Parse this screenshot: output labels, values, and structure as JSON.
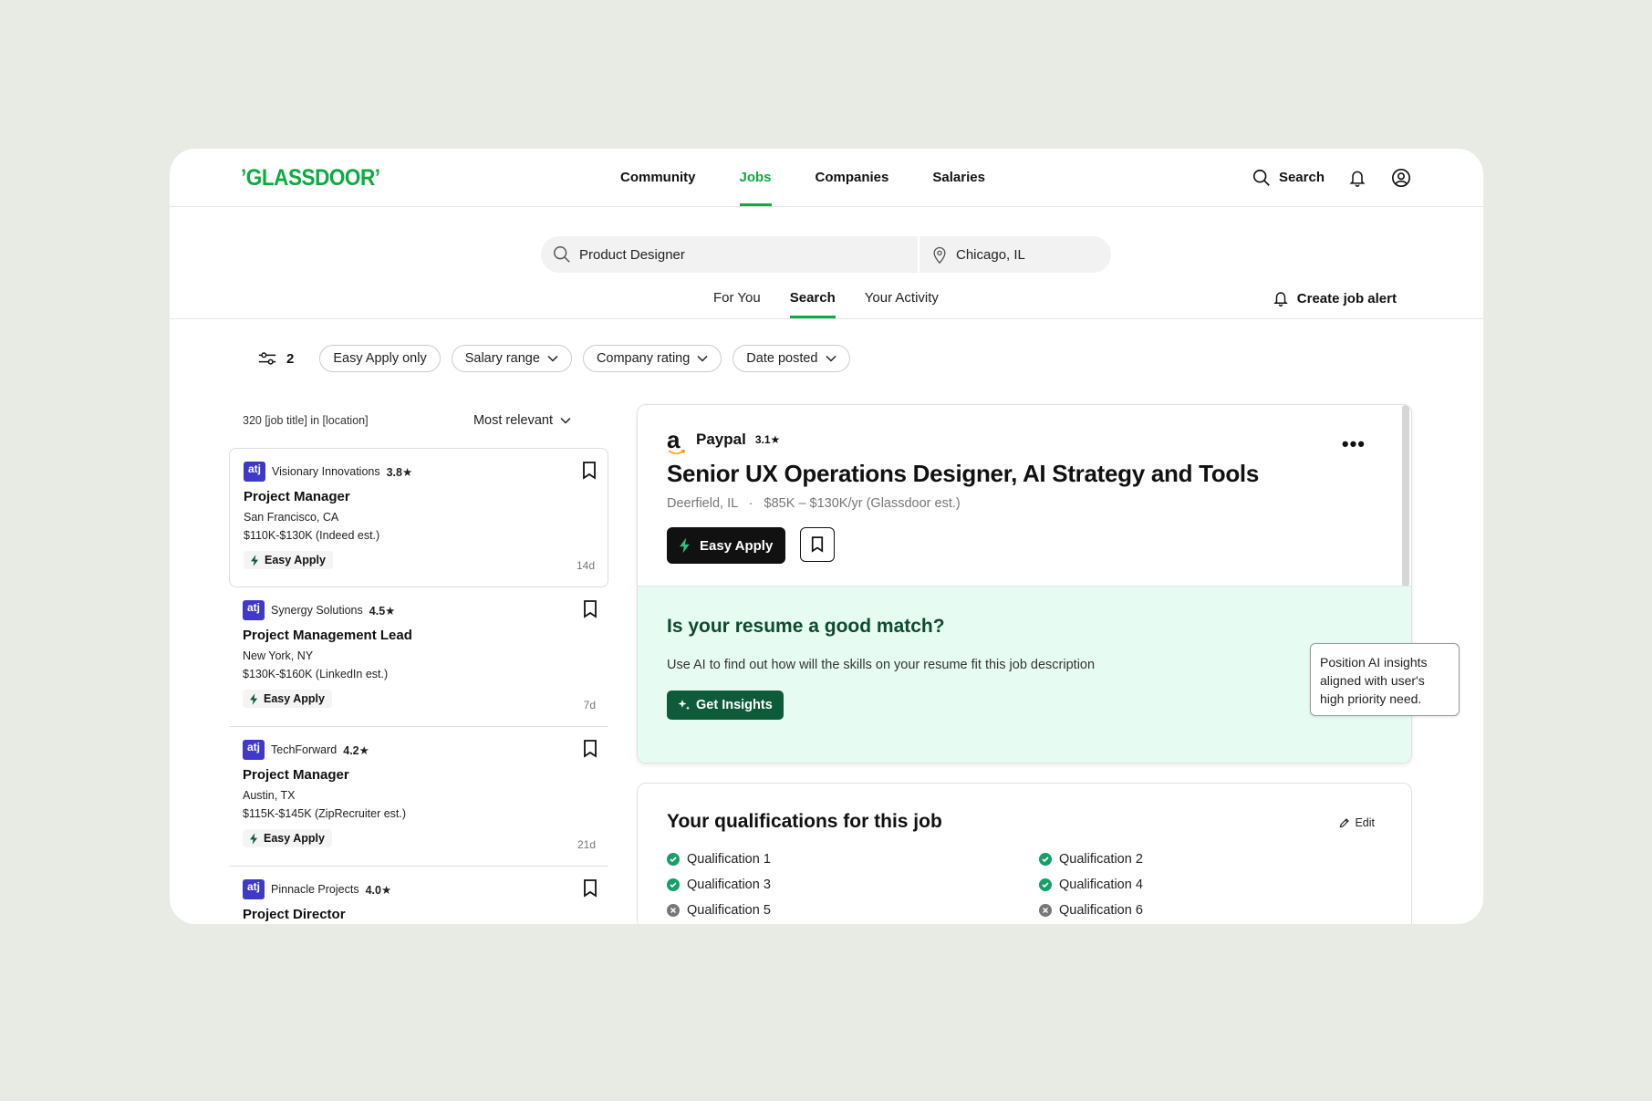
{
  "brand": {
    "logo": "GLASSDOOR",
    "accent": "#0caa41"
  },
  "nav": {
    "links": [
      "Community",
      "Jobs",
      "Companies",
      "Salaries"
    ],
    "active": "Jobs",
    "search_label": "Search"
  },
  "search": {
    "job_value": "Product Designer",
    "location_value": "Chicago, IL"
  },
  "subtabs": {
    "items": [
      "For You",
      "Search",
      "Your Activity"
    ],
    "active": "Search",
    "job_alert": "Create job alert"
  },
  "filters": {
    "count": "2",
    "chips": [
      "Easy Apply only",
      "Salary range",
      "Company rating",
      "Date posted"
    ]
  },
  "list": {
    "results_text": "320 [job title] in [location]",
    "sort_label": "Most relevant",
    "jobs": [
      {
        "company": "Visionary Innovations",
        "rating": "3.8★",
        "title": "Project Manager",
        "location": "San Francisco, CA",
        "salary": "$110K-$130K (Indeed est.)",
        "easy_apply": "Easy Apply",
        "age": "14d"
      },
      {
        "company": "Synergy Solutions",
        "rating": "4.5★",
        "title": "Project Management Lead",
        "location": "New York, NY",
        "salary": "$130K-$160K (LinkedIn est.)",
        "easy_apply": "Easy Apply",
        "age": "7d"
      },
      {
        "company": "TechForward",
        "rating": "4.2★",
        "title": "Project Manager",
        "location": "Austin, TX",
        "salary": "$115K-$145K (ZipRecruiter est.)",
        "easy_apply": "Easy Apply",
        "age": "21d"
      },
      {
        "company": "Pinnacle Projects",
        "rating": "4.0★",
        "title": "Project Director",
        "location": "",
        "salary": "",
        "easy_apply": "",
        "age": ""
      }
    ],
    "logo_text": "atj"
  },
  "detail": {
    "company": "Paypal",
    "rating": "3.1★",
    "logo_glyph": "a",
    "title": "Senior UX Operations Designer, AI Strategy and Tools",
    "location": "Deerfield, IL",
    "salary": "$85K – $130K/yr (Glassdoor est.)",
    "easy_apply": "Easy Apply",
    "menu": "•••"
  },
  "insights": {
    "title": "Is your resume a good match?",
    "text": "Use AI to find out how will the skills on your resume fit this job description",
    "button": "Get Insights",
    "tooltip": "Position AI insights aligned with user's high priority need."
  },
  "qualifications": {
    "title": "Your qualifications for this job",
    "edit": "Edit",
    "items": [
      {
        "label": "Qualification 1",
        "met": true
      },
      {
        "label": "Qualification 2",
        "met": true
      },
      {
        "label": "Qualification 3",
        "met": true
      },
      {
        "label": "Qualification 4",
        "met": true
      },
      {
        "label": "Qualification 5",
        "met": false
      },
      {
        "label": "Qualification 6",
        "met": false
      }
    ]
  }
}
